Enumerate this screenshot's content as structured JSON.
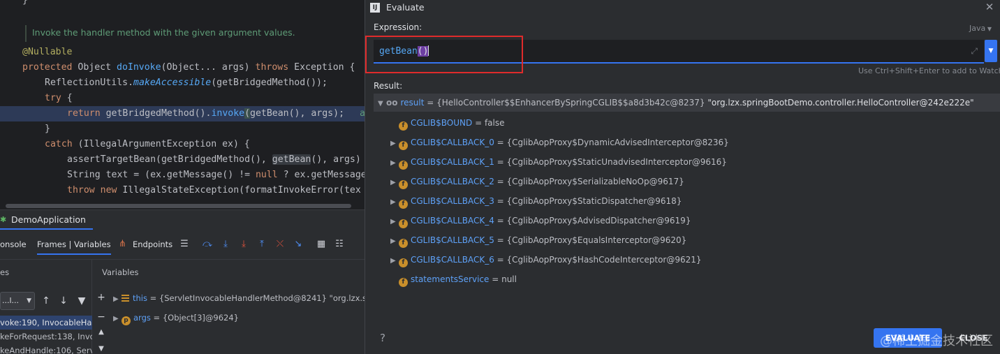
{
  "editor": {
    "brace_top": "}",
    "doc_comment": "Invoke the handler method with the given argument values.",
    "line_annotation": "@Nullable",
    "sig_kw": "protected",
    "sig_type": "Object",
    "sig_fn": "doInvoke",
    "sig_params": "(Object... args)",
    "sig_throws": "throws",
    "sig_exc": "Exception {",
    "l1_a": "ReflectionUtils.",
    "l1_b": "makeAccessible",
    "l1_c": "(getBridgedMethod());",
    "try_kw": "try",
    "try_brace": " {",
    "ret_kw": "return",
    "ret_a": " getBridgedMethod().",
    "ret_b": "invoke",
    "ret_c": "(",
    "ret_d": "getBean(), args);",
    "ret_tail": "a",
    "close_brace": "}",
    "catch_kw": "catch",
    "catch_rest": " (IllegalArgumentException ex) {",
    "atb_a": "assertTargetBean(getBridgedMethod(), ",
    "atb_b": "getBean",
    "atb_c": "(), args)",
    "str_a": "String text = (ex.getMessage() != ",
    "str_null": "null",
    "str_b": " ? ex.getMessage",
    "throw_kw": "throw",
    "throw_new": " new",
    "throw_rest": " IllegalStateException(formatInvokeError(tex"
  },
  "debug": {
    "run_config": "DemoApplication",
    "tabs": {
      "console": "onsole",
      "frames_vars": "Frames | Variables",
      "endpoints": "Endpoints"
    },
    "frames_header": "es",
    "variables_header": "Variables",
    "thread_selector": "...l...",
    "frames": [
      "voke:190, InvocableHa",
      "keForRequest:138, Invoc",
      "keAndHandle:106, Serv"
    ],
    "variables": [
      {
        "name": "this",
        "value": "= {ServletInvocableHandlerMethod@8241} \"org.lzx.s"
      },
      {
        "name": "args",
        "value": "= {Object[3]@9624}"
      }
    ]
  },
  "dialog": {
    "title": "Evaluate",
    "expression_label": "Expression:",
    "language": "Java",
    "expression_fn": "getBean",
    "expression_parens": "()",
    "hint": "Use Ctrl+Shift+Enter to add to Watches",
    "result_label": "Result:",
    "result": {
      "name": "result",
      "value": "= {HelloController$$EnhancerBySpringCGLIB$$a8d3b42c@8237}",
      "string": "\"org.lzx.springBootDemo.controller.HelloController@242e222e\""
    },
    "children": [
      {
        "name": "CGLIB$BOUND",
        "value": "= false",
        "expandable": false
      },
      {
        "name": "CGLIB$CALLBACK_0",
        "value": "= {CglibAopProxy$DynamicAdvisedInterceptor@8236}",
        "expandable": true
      },
      {
        "name": "CGLIB$CALLBACK_1",
        "value": "= {CglibAopProxy$StaticUnadvisedInterceptor@9616}",
        "expandable": true
      },
      {
        "name": "CGLIB$CALLBACK_2",
        "value": "= {CglibAopProxy$SerializableNoOp@9617}",
        "expandable": true
      },
      {
        "name": "CGLIB$CALLBACK_3",
        "value": "= {CglibAopProxy$StaticDispatcher@9618}",
        "expandable": true
      },
      {
        "name": "CGLIB$CALLBACK_4",
        "value": "= {CglibAopProxy$AdvisedDispatcher@9619}",
        "expandable": true
      },
      {
        "name": "CGLIB$CALLBACK_5",
        "value": "= {CglibAopProxy$EqualsInterceptor@9620}",
        "expandable": true
      },
      {
        "name": "CGLIB$CALLBACK_6",
        "value": "= {CglibAopProxy$HashCodeInterceptor@9621}",
        "expandable": true
      },
      {
        "name": "statementsService",
        "value": "= null",
        "expandable": false
      }
    ],
    "help": "?",
    "evaluate_button": "EVALUATE",
    "close_button": "CLOSE"
  },
  "watermark": "@稀土掘金技术社区",
  "icons": {
    "field_badge": "f",
    "param_badge": "p",
    "app_logo": "IJ"
  },
  "colors": {
    "accent": "#3574f0",
    "highlight_box": "#e02b2b",
    "field_badge": "#c98f2b",
    "var_name": "#5ea1f7"
  }
}
